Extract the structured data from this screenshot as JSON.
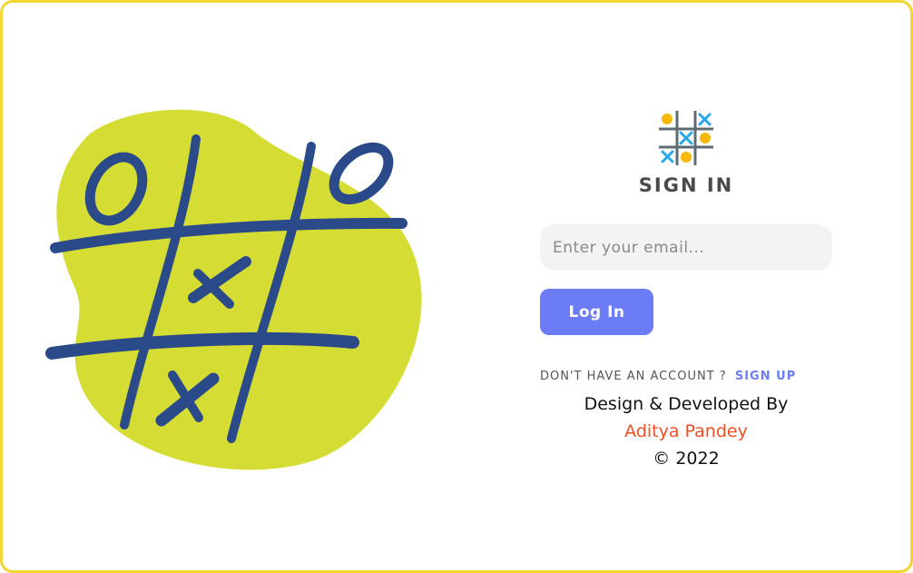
{
  "signin": {
    "title": "SIGN IN",
    "email_placeholder": "Enter your email...",
    "login_label": "Log In",
    "no_account_text": "DON'T HAVE AN ACCOUNT ?",
    "signup_label": "SIGN UP"
  },
  "credits": {
    "line1": "Design & Developed By",
    "author": "Aditya Pandey",
    "copyright": "© 2022"
  },
  "colors": {
    "frame_border": "#f2d733",
    "blob": "#d5dc33",
    "grid_strokes": "#2a4a8a",
    "button": "#6b7cf6",
    "signup_link": "#6b7cf6",
    "author": "#f04e23"
  },
  "icons": {
    "hero": "tic-tac-toe-illustration",
    "logo": "tic-tac-toe-logo-icon"
  }
}
